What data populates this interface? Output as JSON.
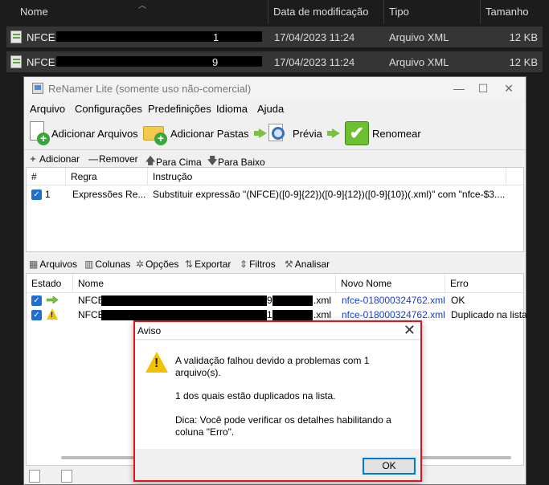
{
  "explorer": {
    "columns": {
      "name": "Nome",
      "modified": "Data de modificação",
      "type": "Tipo",
      "size": "Tamanho"
    },
    "files": [
      {
        "name": "NFCE",
        "suffix": "1",
        "date": "17/04/2023 11:24",
        "type": "Arquivo XML",
        "size": "12 KB"
      },
      {
        "name": "NFCE",
        "suffix": "9",
        "date": "17/04/2023 11:24",
        "type": "Arquivo XML",
        "size": "12 KB"
      }
    ]
  },
  "window": {
    "title": "ReNamer Lite (somente uso não-comercial)",
    "controls": {
      "minimize": "—",
      "maximize": "☐",
      "close": "✕"
    }
  },
  "menu": [
    "Arquivo",
    "Configurações",
    "Predefinições",
    "Idioma",
    "Ajuda"
  ],
  "toolbar": {
    "add_files": "Adicionar Arquivos",
    "add_folders": "Adicionar Pastas",
    "preview": "Prévia",
    "rename": "Renomear"
  },
  "rules_toolbar": {
    "add": "Adicionar",
    "remove": "Remover",
    "up": "Para Cima",
    "down": "Para Baixo"
  },
  "rules": {
    "columns": {
      "num": "#",
      "rule": "Regra",
      "instruction": "Instrução"
    },
    "rows": [
      {
        "num": "1",
        "rule": "Expressões Re...",
        "instruction": "Substituir expressão \"(NFCE)([0-9]{22})([0-9]{12})([0-9]{10})(.xml)\" com \"nfce-$3...."
      }
    ]
  },
  "files_toolbar": {
    "files": "Arquivos",
    "columns": "Colunas",
    "options": "Opções",
    "export": "Exportar",
    "filters": "Filtros",
    "analyze": "Analisar"
  },
  "files": {
    "columns": {
      "state": "Estado",
      "name": "Nome",
      "new_name": "Novo Nome",
      "error": "Erro"
    },
    "rows": [
      {
        "name_prefix": "NFCE",
        "name_mid": "9",
        "ext": ".xml",
        "new_name": "nfce-018000324762.xml",
        "error": "OK"
      },
      {
        "name_prefix": "NFCE",
        "name_mid": "1",
        "ext": ".xml",
        "new_name": "nfce-018000324762.xml",
        "error": "Duplicado na lista"
      }
    ]
  },
  "dialog": {
    "title": "Aviso",
    "close": "✕",
    "line1": "A validação falhou devido a problemas com 1",
    "line2": "arquivo(s).",
    "line3": "1 dos quais estão duplicados na lista.",
    "line4": "Dica: Você pode verificar os detalhes habilitando a",
    "line5": "coluna \"Erro\".",
    "ok": "OK"
  },
  "colors": {
    "accent": "#0078d7",
    "highlight_border": "#e0141e",
    "new_name": "#1a3fcc"
  }
}
